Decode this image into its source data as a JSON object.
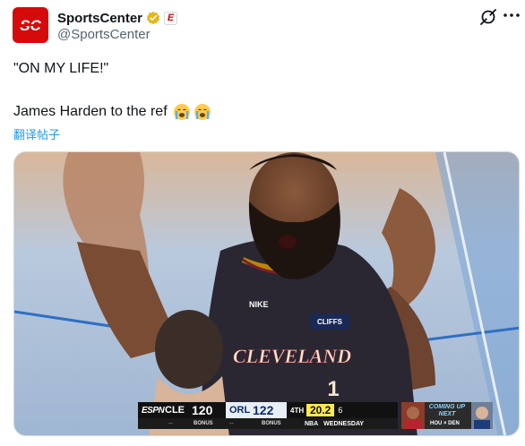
{
  "account": {
    "display_name": "SportsCenter",
    "handle": "@SportsCenter",
    "avatar_text": "SC",
    "affiliate_badge": "E"
  },
  "tweet": {
    "line1": "\"ON MY LIFE!\"",
    "line2": "James Harden to the ref",
    "emojis": [
      "loudly-crying-face",
      "loudly-crying-face"
    ],
    "translate_label": "翻译帖子"
  },
  "media": {
    "jersey_text": "CLEVELAND",
    "jersey_number": "1",
    "sponsor": "CLIFFS",
    "brand": "NIKE",
    "scorebug": {
      "network": "ESPN",
      "away_team": "CLE",
      "away_score": "120",
      "home_team": "ORL",
      "home_score": "122",
      "quarter": "4TH",
      "clock": "20.2",
      "shot_clock": "6",
      "away_bonus": "BONUS",
      "home_bonus": "BONUS",
      "away_dash": "--",
      "home_dash": "--",
      "day": "WEDNESDAY",
      "league": "NBA",
      "coming_up": "COMING UP",
      "next": "NEXT",
      "next_game": "HOU × DEN"
    }
  },
  "colors": {
    "brand_red": "#d50a0a",
    "link_blue": "#1d9bf0",
    "verified_gold": "#e2b719",
    "secondary_text": "#536471"
  }
}
